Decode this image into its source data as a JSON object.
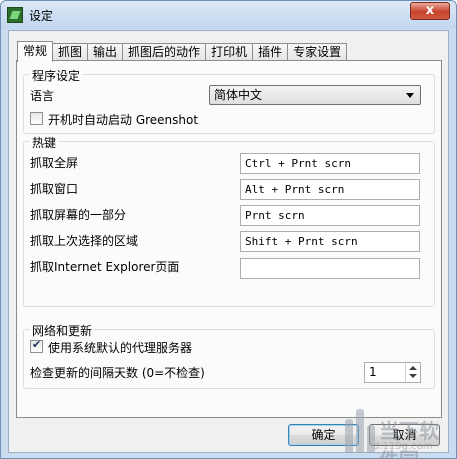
{
  "window": {
    "title": "设定",
    "close_glyph": "x"
  },
  "tabs": [
    {
      "label": "常规",
      "active": true
    },
    {
      "label": "抓图"
    },
    {
      "label": "输出"
    },
    {
      "label": "抓图后的动作"
    },
    {
      "label": "打印机"
    },
    {
      "label": "插件"
    },
    {
      "label": "专家设置"
    }
  ],
  "program_settings": {
    "legend": "程序设定",
    "language_label": "语言",
    "language_value": "简体中文",
    "autostart_label": "开机时自动启动 Greenshot",
    "autostart_checked": false
  },
  "hotkeys": {
    "legend": "热键",
    "rows": [
      {
        "label": "抓取全屏",
        "value": "Ctrl + Prnt scrn"
      },
      {
        "label": "抓取窗口",
        "value": "Alt + Prnt scrn"
      },
      {
        "label": "抓取屏幕的一部分",
        "value": "Prnt scrn"
      },
      {
        "label": "抓取上次选择的区域",
        "value": "Shift + Prnt scrn"
      },
      {
        "label": "抓取Internet Explorer页面",
        "value": ""
      }
    ]
  },
  "network": {
    "legend": "网络和更新",
    "proxy_label": "使用系统默认的代理服务器",
    "proxy_checked": true,
    "update_label": "检查更新的间隔天数 (0=不检查)",
    "update_value": "1"
  },
  "buttons": {
    "ok": "确定",
    "cancel": "取消"
  },
  "watermark": {
    "text": "当下软件园",
    "url": "d.119g.com"
  },
  "colors": {
    "window_frame": "#c9dcf0",
    "close_button": "#c7432c",
    "panel": "#fbfbfb"
  }
}
